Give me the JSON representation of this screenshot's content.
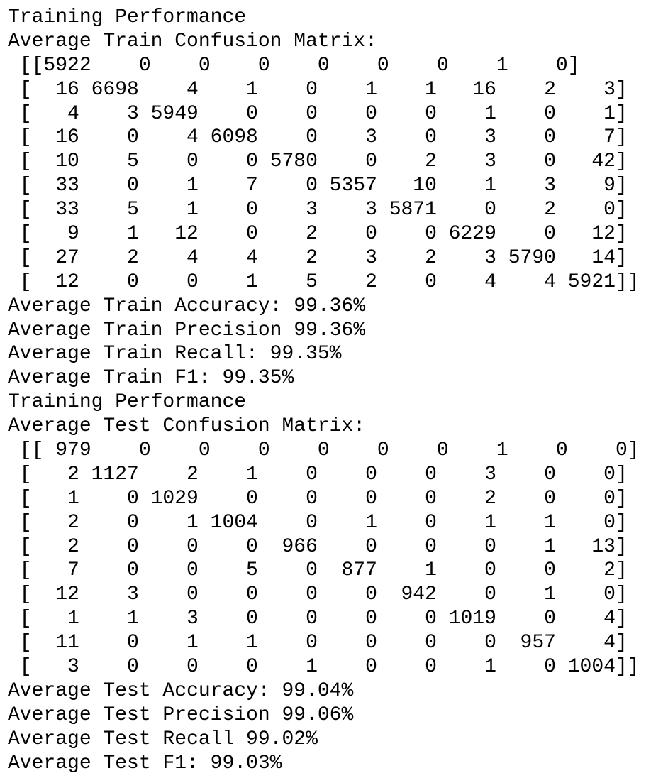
{
  "output": {
    "train": {
      "heading": "Training Performance",
      "matrix_title": "Average Train Confusion Matrix:",
      "matrix_rows": [
        " [[5922    0    0    0    0    0    0    1    0]",
        " [  16 6698    4    1    0    1    1   16    2    3]",
        " [   4    3 5949    0    0    0    0    1    0    1]",
        " [  16    0    4 6098    0    3    0    3    0    7]",
        " [  10    5    0    0 5780    0    2    3    0   42]",
        " [  33    0    1    7    0 5357   10    1    3    9]",
        " [  33    5    1    0    3    3 5871    0    2    0]",
        " [   9    1   12    0    2    0    0 6229    0   12]",
        " [  27    2    4    4    2    3    2    3 5790   14]",
        " [  12    0    0    1    5    2    0    4    4 5921]]"
      ],
      "metrics": [
        "Average Train Accuracy: 99.36%",
        "Average Train Precision 99.36%",
        "Average Train Recall: 99.35%",
        "Average Train F1: 99.35%"
      ]
    },
    "test": {
      "heading": "Training Performance",
      "matrix_title": "Average Test Confusion Matrix:",
      "matrix_rows": [
        " [[ 979    0    0    0    0    0    0    1    0    0]",
        " [   2 1127    2    1    0    0    0    3    0    0]",
        " [   1    0 1029    0    0    0    0    2    0    0]",
        " [   2    0    1 1004    0    1    0    1    1    0]",
        " [   2    0    0    0  966    0    0    0    1   13]",
        " [   7    0    0    5    0  877    1    0    0    2]",
        " [  12    3    0    0    0    0  942    0    1    0]",
        " [   1    1    3    0    0    0    0 1019    0    4]",
        " [  11    0    1    1    0    0    0    0  957    4]",
        " [   3    0    0    0    1    0    0    1    0 1004]]"
      ],
      "metrics": [
        "Average Test Accuracy: 99.04%",
        "Average Test Precision 99.06%",
        "Average Test Recall 99.02%",
        "Average Test F1: 99.03%"
      ]
    }
  }
}
